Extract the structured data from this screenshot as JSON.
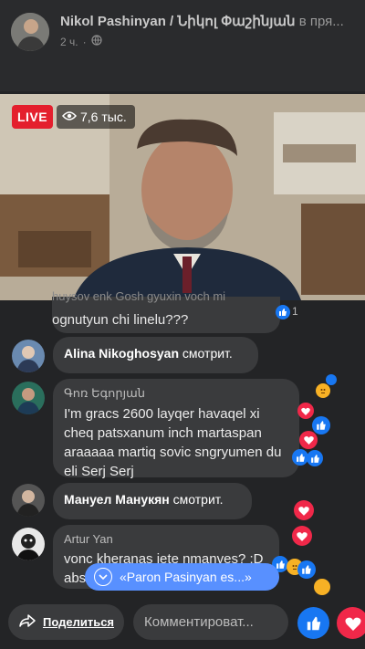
{
  "header": {
    "page_name": "Nikol Pashinyan / Նիկոլ Փաշինյան",
    "name_tail": "в пря...",
    "time": "2 ч.",
    "separator": "·"
  },
  "video": {
    "live_label": "LIVE",
    "viewers": "7,6 тыс."
  },
  "comments": {
    "top_faded": "huysov enk Gosh gyuxin voch mi",
    "top_text": "ognutyun chi linelu???",
    "top_like_count": "1",
    "alina_name": "Alina Nikoghosyan",
    "alina_suffix": "смотрит.",
    "gor_name": "Գոռ Եգորյան",
    "gor_text": "I'm gracs 2600 layqer havaqel xi cheq patsxanum inch martaspan araaaaa martiq sovic sngryumen du eli Serj Serj",
    "manuel_name": "Мануел Манукян",
    "manuel_suffix": "смотрит.",
    "artur_name": "Artur Yan",
    "artur_text_1": "vonc kheranas jete nmanves? :D",
    "artur_text_2": "abs"
  },
  "pill": {
    "label": "«Paron Pasinyan es...»"
  },
  "footer": {
    "share_label": "Поделиться",
    "comment_placeholder": "Комментироват..."
  },
  "colors": {
    "live_red": "#e41f2d",
    "like_blue": "#1877f2",
    "heart_red": "#f02849",
    "pill_blue": "#5890ff"
  },
  "icons": [
    "globe-icon",
    "eye-icon",
    "like-icon",
    "heart-icon",
    "angry-icon",
    "share-arrow-icon",
    "chevron-down-icon"
  ]
}
